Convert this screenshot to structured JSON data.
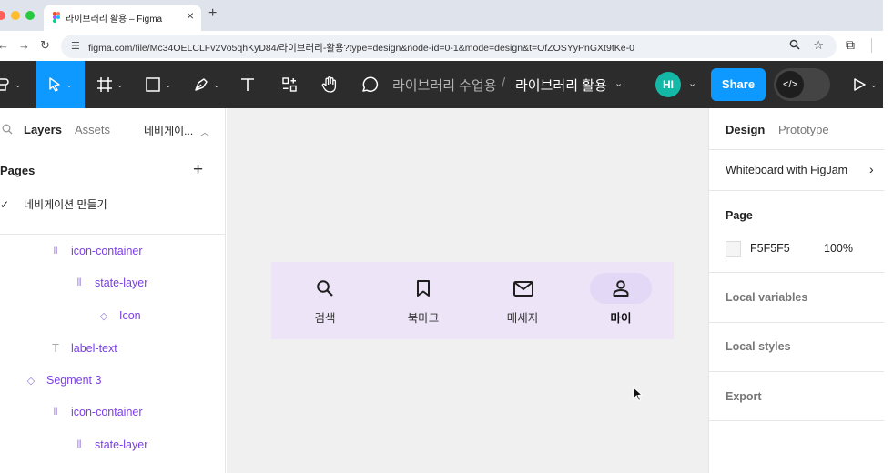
{
  "browser": {
    "tab_title": "라이브러리 활용 – Figma",
    "url": "figma.com/file/Mc34OELCLFv2Vo5qhKyD84/라이브러리-활용?type=design&node-id=0-1&mode=design&t=OfZOSYyPnGXt9tKe-0"
  },
  "toolbar": {
    "breadcrumb_project": "라이브러리 수업용",
    "breadcrumb_sep": "/",
    "file_name": "라이브러리 활용",
    "avatar_initials": "HI",
    "share_label": "Share"
  },
  "left_panel": {
    "tabs": [
      "Layers",
      "Assets"
    ],
    "current_page_short": "네비게이...",
    "pages_title": "Pages",
    "page_name": "네비게이션 만들기",
    "layers": [
      {
        "name": "icon-container",
        "icon": "auto-layout-icon"
      },
      {
        "name": "state-layer",
        "icon": "auto-layout-icon"
      },
      {
        "name": "Icon",
        "icon": "instance-icon"
      },
      {
        "name": "label-text",
        "icon": "text-icon"
      },
      {
        "name": "Segment 3",
        "icon": "instance-icon"
      },
      {
        "name": "icon-container",
        "icon": "auto-layout-icon"
      },
      {
        "name": "state-layer",
        "icon": "auto-layout-icon"
      }
    ]
  },
  "canvas": {
    "nav_items": [
      {
        "label": "검색",
        "icon": "search-icon",
        "active": false
      },
      {
        "label": "북마크",
        "icon": "bookmark-icon",
        "active": false
      },
      {
        "label": "메세지",
        "icon": "mail-icon",
        "active": false
      },
      {
        "label": "마이",
        "icon": "person-icon",
        "active": true
      }
    ],
    "colors": {
      "canvas_bg": "#f0f0f0",
      "navbar_bg": "#ede5f7",
      "active_pill": "#e3d8f6"
    }
  },
  "right_panel": {
    "tabs": [
      "Design",
      "Prototype"
    ],
    "whiteboard_label": "Whiteboard with FigJam",
    "page_title": "Page",
    "page_color": "F5F5F5",
    "page_opacity": "100%",
    "local_variables": "Local variables",
    "local_styles": "Local styles",
    "export": "Export"
  },
  "colors": {
    "accent": "#0d99ff",
    "layer_purple": "#7b3fe4",
    "toolbar_bg": "#2c2c2c"
  }
}
